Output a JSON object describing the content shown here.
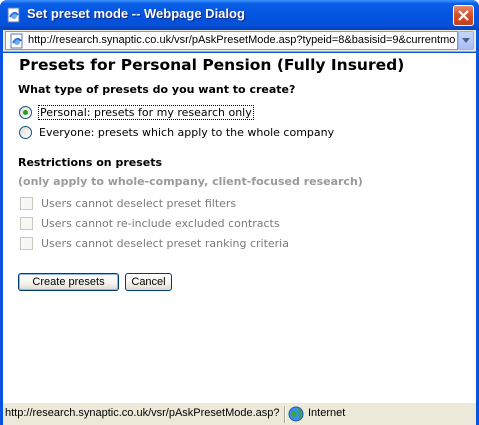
{
  "window": {
    "title": "Set preset mode -- Webpage Dialog"
  },
  "addressbar": {
    "url": "http://research.synaptic.co.uk/vsr/pAskPresetMode.asp?typeid=8&basisid=9&currentmo"
  },
  "page": {
    "title": "Presets for Personal Pension (Fully Insured)",
    "question": "What type of presets do you want to create?",
    "options": [
      {
        "label": "Personal: presets for my research only",
        "selected": true
      },
      {
        "label": "Everyone: presets which apply to the whole company",
        "selected": false
      }
    ],
    "restrictions_heading": "Restrictions on presets",
    "restrictions_note": "(only apply to whole-company, client-focused research)",
    "restrictions": [
      {
        "label": "Users cannot deselect preset filters",
        "checked": false
      },
      {
        "label": "Users cannot re-include excluded contracts",
        "checked": false
      },
      {
        "label": "Users cannot deselect preset ranking criteria",
        "checked": false
      }
    ],
    "buttons": {
      "create": "Create presets",
      "cancel": "Cancel"
    }
  },
  "statusbar": {
    "url": "http://research.synaptic.co.uk/vsr/pAskPresetMode.asp?",
    "zone": "Internet"
  },
  "colors": {
    "titlebar": "#0354e0",
    "close_button": "#d6502d",
    "radio_dot": "#21a121",
    "disabled_text": "#7a7a7a"
  }
}
